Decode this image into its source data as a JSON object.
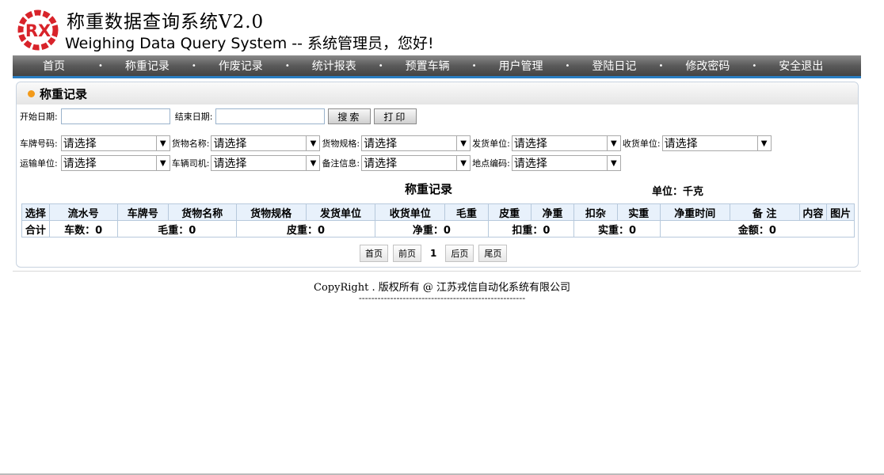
{
  "header": {
    "logo_text": "RX",
    "title": "称重数据查询系统V2.0",
    "subtitle": "Weighing Data Query System -- 系统管理员，您好!"
  },
  "nav": {
    "items": [
      "首页",
      "称重记录",
      "作废记录",
      "统计报表",
      "预置车辆",
      "用户管理",
      "登陆日记",
      "修改密码",
      "安全退出"
    ]
  },
  "panel": {
    "title": "称重记录"
  },
  "filters": {
    "start_date_label": "开始日期:",
    "end_date_label": "结束日期:",
    "start_date_value": "",
    "end_date_value": "",
    "search_button": "搜索",
    "print_button": "打印",
    "placeholder_option": "请选择",
    "row1": [
      {
        "label": "车牌号码:",
        "value": "请选择"
      },
      {
        "label": "货物名称:",
        "value": "请选择"
      },
      {
        "label": "货物规格:",
        "value": "请选择"
      },
      {
        "label": "发货单位:",
        "value": "请选择"
      },
      {
        "label": "收货单位:",
        "value": "请选择"
      }
    ],
    "row2": [
      {
        "label": "运输单位:",
        "value": "请选择"
      },
      {
        "label": "车辆司机:",
        "value": "请选择"
      },
      {
        "label": "备注信息:",
        "value": "请选择"
      },
      {
        "label": "地点编码:",
        "value": "请选择"
      }
    ]
  },
  "table": {
    "caption": "称重记录",
    "unit": "单位：千克",
    "columns": [
      "选择",
      "流水号",
      "车牌号",
      "货物名称",
      "货物规格",
      "发货单位",
      "收货单位",
      "毛重",
      "皮重",
      "净重",
      "扣杂",
      "实重",
      "净重时间",
      "备 注",
      "内容",
      "图片"
    ],
    "summary": {
      "label": "合计",
      "vehicle_count": "车数：0",
      "gross": "毛重：0",
      "tare": "皮重：0",
      "net": "净重：0",
      "deduct": "扣重：0",
      "actual": "实重：0",
      "amount": "金额：0"
    }
  },
  "pager": {
    "first": "首页",
    "prev": "前页",
    "current": "1",
    "next": "后页",
    "last": "尾页"
  },
  "footer": {
    "copyright": "CopyRight . 版权所有 @ 江苏戎信自动化系统有限公司",
    "dashes": "-----------------------------------------------------"
  },
  "colors": {
    "accent_orange": "#f39a1a",
    "nav_bottom_blue": "#2a7fc4",
    "logo_red": "#d8232a"
  }
}
